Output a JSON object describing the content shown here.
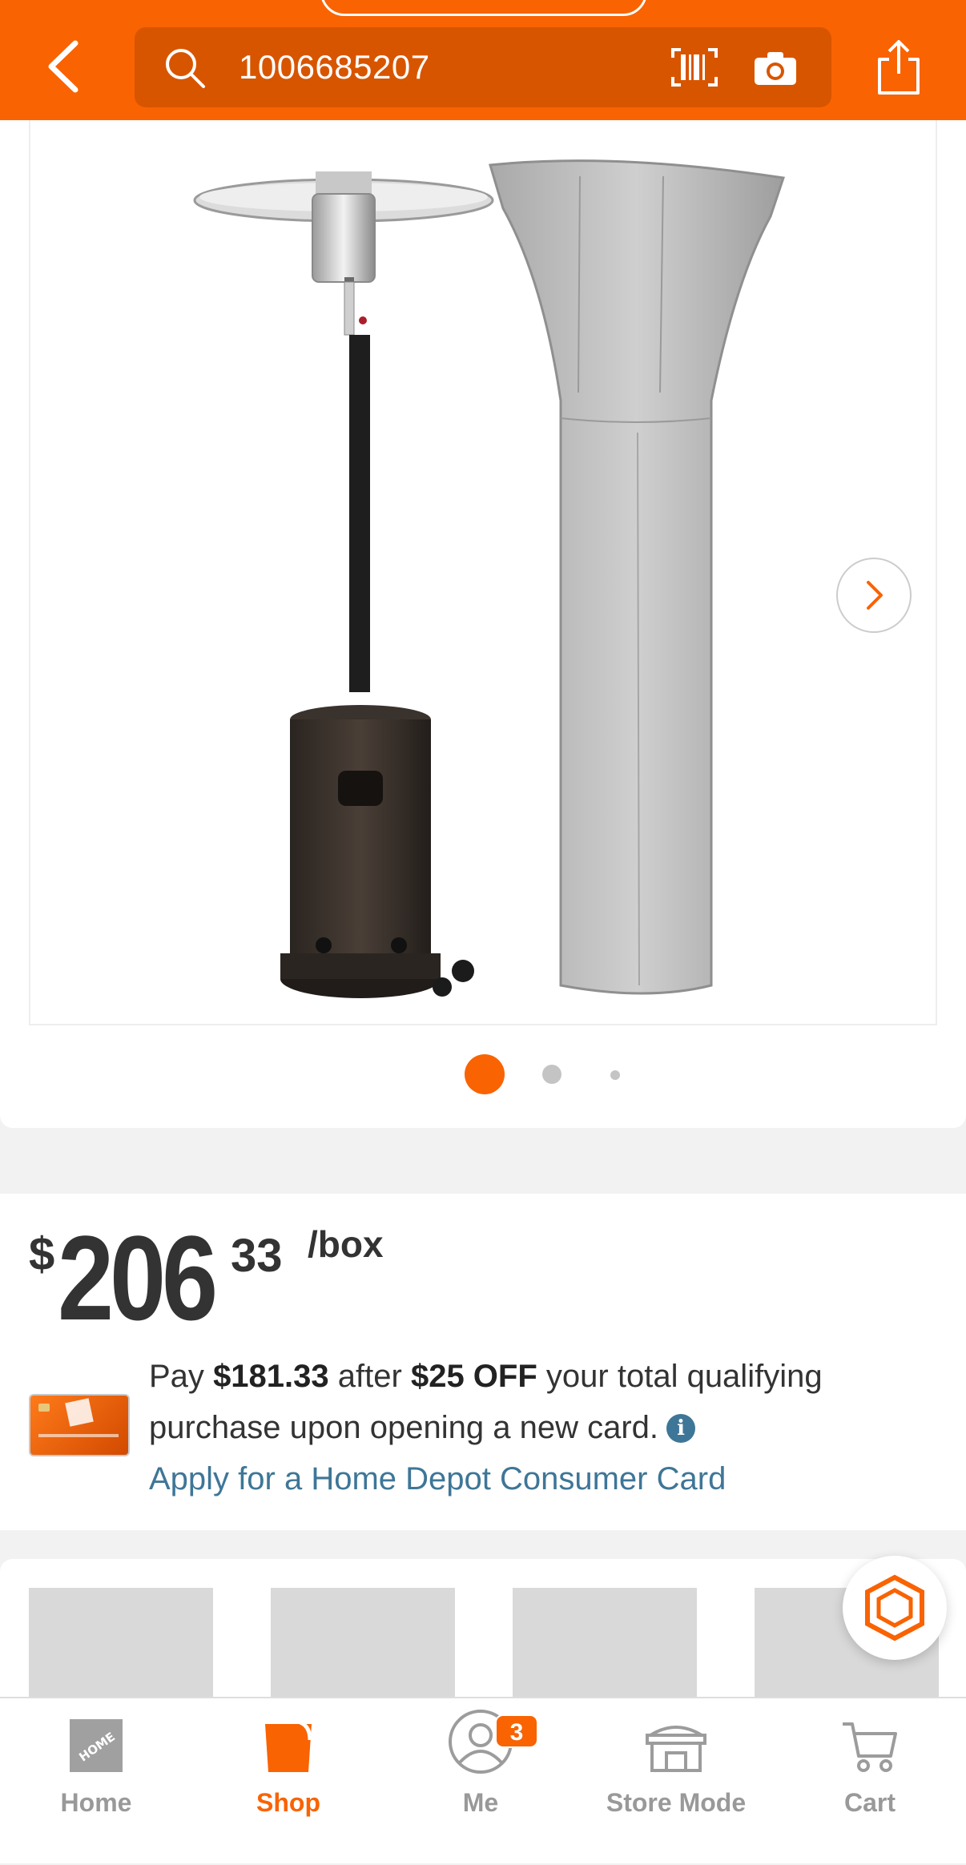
{
  "header": {
    "search_value": "1006685207",
    "icons": [
      "back-icon",
      "search-icon",
      "barcode-scan-icon",
      "camera-icon",
      "share-icon"
    ]
  },
  "gallery": {
    "image_description_icon": "patio-heater-with-cover-image",
    "current_index": 1,
    "total_images": 3
  },
  "price": {
    "currency": "$",
    "dollars": "206",
    "cents": "33",
    "unit": "/box"
  },
  "promo": {
    "pay": "Pay",
    "discounted_price": "$181.33",
    "after": "after",
    "discount": "$25 OFF",
    "rest_line": "your total qualifying purchase upon opening a new card.",
    "info_glyph": "i",
    "apply_link": "Apply for a Home Depot Consumer Card"
  },
  "tabbar": {
    "tabs": [
      {
        "label": "Home",
        "icon": "home-depot-logo-icon",
        "active": false
      },
      {
        "label": "Shop",
        "icon": "shop-bucket-icon",
        "active": true
      },
      {
        "label": "Me",
        "icon": "user-icon",
        "active": false,
        "badge": "3"
      },
      {
        "label": "Store Mode",
        "icon": "store-icon",
        "active": false
      },
      {
        "label": "Cart",
        "icon": "cart-icon",
        "active": false
      }
    ]
  },
  "colors": {
    "brand_orange": "#f96302",
    "search_bg": "#d85500",
    "link_blue": "#3e7697"
  }
}
